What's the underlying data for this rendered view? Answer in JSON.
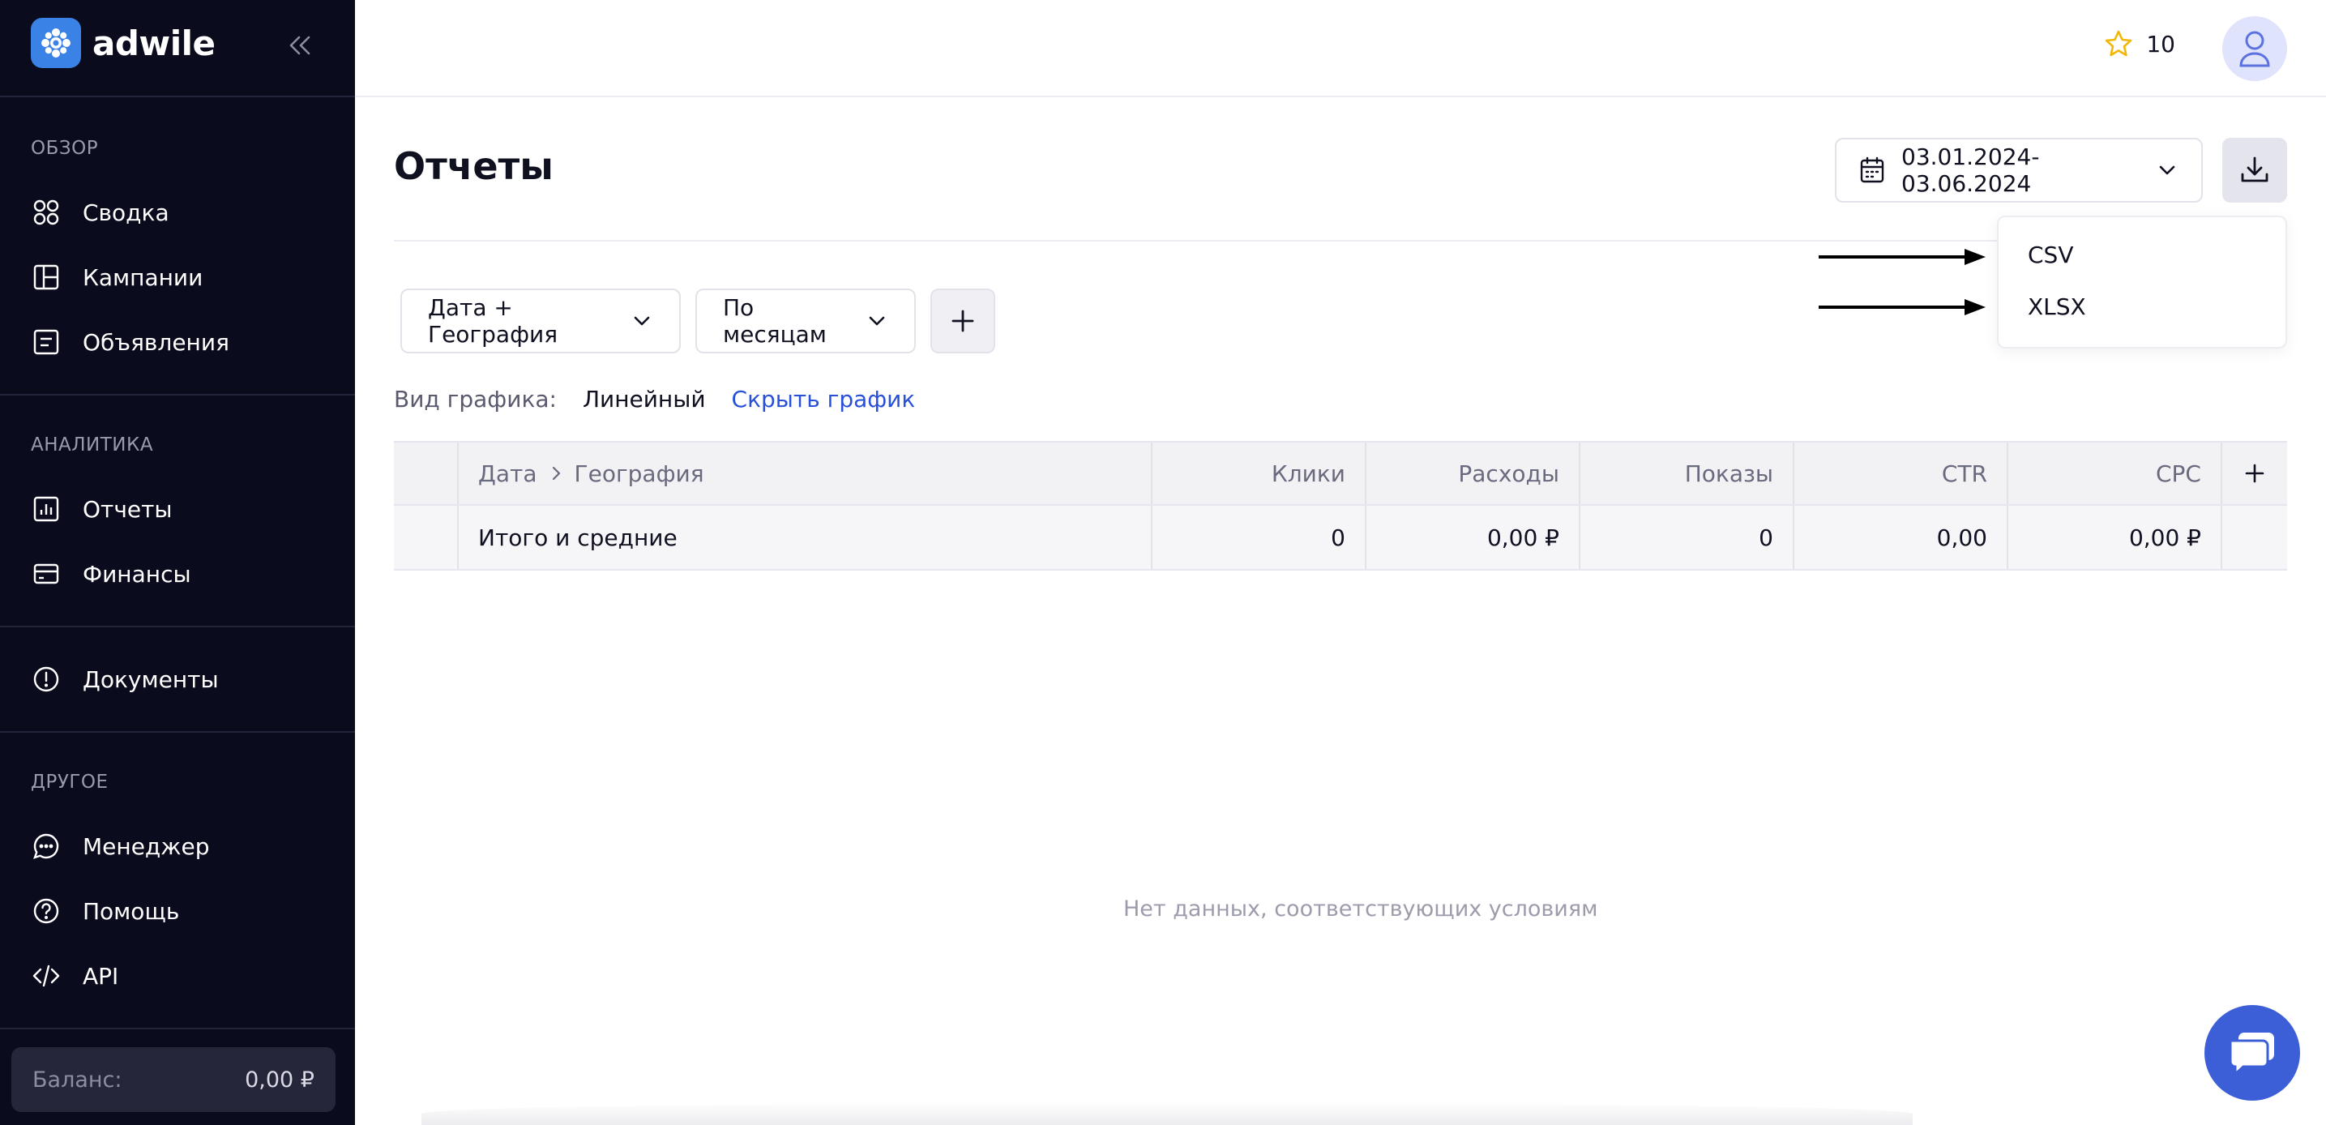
{
  "brand": {
    "name": "adwile"
  },
  "sidebar": {
    "sections": [
      {
        "title": "ОБЗОР",
        "items": [
          {
            "label": "Сводка",
            "icon": "dashboard-icon"
          },
          {
            "label": "Кампании",
            "icon": "campaigns-icon"
          },
          {
            "label": "Объявления",
            "icon": "ads-icon"
          }
        ]
      },
      {
        "title": "АНАЛИТИКА",
        "items": [
          {
            "label": "Отчеты",
            "icon": "reports-icon"
          },
          {
            "label": "Финансы",
            "icon": "finance-icon"
          }
        ]
      },
      {
        "title": "",
        "items": [
          {
            "label": "Документы",
            "icon": "documents-icon"
          }
        ]
      },
      {
        "title": "ДРУГОЕ",
        "items": [
          {
            "label": "Менеджер",
            "icon": "chat-bubble-icon"
          },
          {
            "label": "Помощь",
            "icon": "help-icon"
          },
          {
            "label": "API",
            "icon": "code-icon"
          }
        ]
      }
    ],
    "balance": {
      "label": "Баланс:",
      "value": "0,00 ₽"
    }
  },
  "topbar": {
    "star_count": "10"
  },
  "page": {
    "title": "Отчеты",
    "date_range": "03.01.2024-03.06.2024",
    "export_menu": [
      "CSV",
      "XLSX"
    ],
    "filters": {
      "grouping": "Дата + География",
      "period": "По месяцам"
    },
    "chart": {
      "label": "Вид графика:",
      "type": "Линейный",
      "hide_link": "Скрыть график"
    }
  },
  "table": {
    "breadcrumb": [
      "Дата",
      "География"
    ],
    "columns": [
      "Клики",
      "Расходы",
      "Показы",
      "CTR",
      "CPC"
    ],
    "total_row": {
      "label": "Итого и средние",
      "values": [
        "0",
        "0,00 ₽",
        "0",
        "0,00",
        "0,00 ₽"
      ]
    },
    "add_column": "+",
    "empty_message": "Нет данных, соответствующих условиям"
  },
  "colors": {
    "sidebar_bg": "#0b0b1e",
    "accent": "#3c5fd8",
    "link": "#2850d8",
    "star": "#f2b705"
  }
}
